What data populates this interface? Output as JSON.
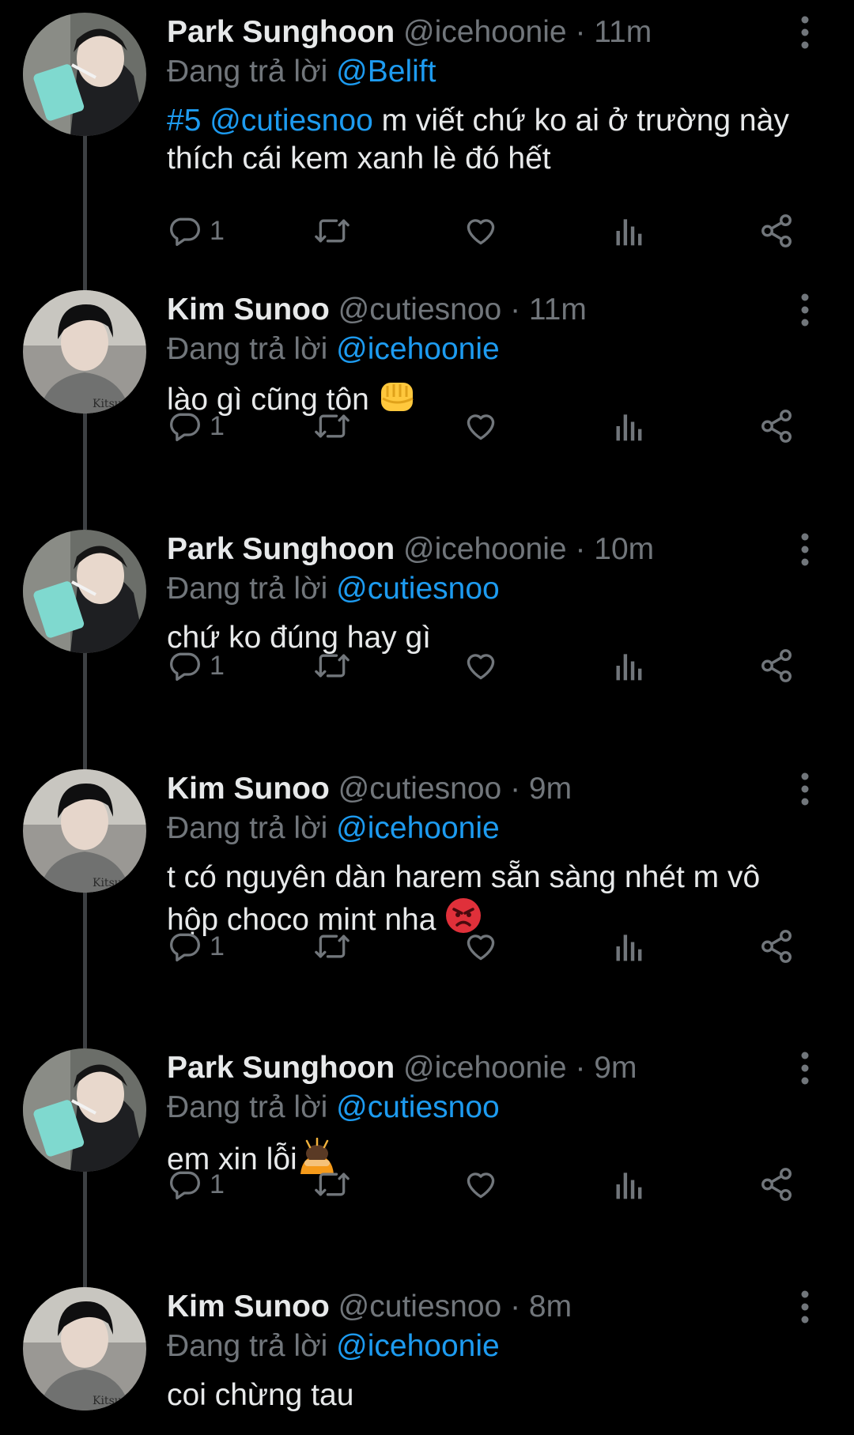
{
  "labels": {
    "replying_prefix": "Đang trả lời"
  },
  "colors": {
    "background": "#000000",
    "text": "#e7e9ea",
    "muted": "#71767b",
    "link": "#1d9bf0",
    "thread_line": "#3d4043"
  },
  "tweets": [
    {
      "name": "Park Sunghoon",
      "handle": "@icehoonie",
      "time": "· 11m",
      "replying_to": "@Belift",
      "body_links": "#5 @cutiesnoo",
      "body_text": "m viết chứ ko ai ở trường này thích cái kem xanh lè đó hết",
      "reply_count": "1",
      "avatar": "sunghoon-avatar"
    },
    {
      "name": "Kim Sunoo",
      "handle": "@cutiesnoo",
      "time": "· 11m",
      "replying_to": "@icehoonie",
      "body_text": "lào gì cũng tôn",
      "emoji": "fist-emoji",
      "reply_count": "1",
      "avatar": "sunoo-avatar"
    },
    {
      "name": "Park Sunghoon",
      "handle": "@icehoonie",
      "time": "· 10m",
      "replying_to": "@cutiesnoo",
      "body_text": "chứ ko đúng hay gì",
      "reply_count": "1",
      "avatar": "sunghoon-avatar"
    },
    {
      "name": "Kim Sunoo",
      "handle": "@cutiesnoo",
      "time": "· 9m",
      "replying_to": "@icehoonie",
      "body_text": "t có nguyên dàn harem sẵn sàng nhét m vô hộp choco mint nha",
      "emoji": "angry-face-emoji",
      "reply_count": "1",
      "avatar": "sunoo-avatar"
    },
    {
      "name": "Park Sunghoon",
      "handle": "@icehoonie",
      "time": "· 9m",
      "replying_to": "@cutiesnoo",
      "body_text": "em xin lỗi",
      "emoji": "bowing-person-emoji",
      "reply_count": "1",
      "avatar": "sunghoon-avatar"
    },
    {
      "name": "Kim Sunoo",
      "handle": "@cutiesnoo",
      "time": "· 8m",
      "replying_to": "@icehoonie",
      "body_text": "coi chừng tau",
      "avatar": "sunoo-avatar"
    }
  ]
}
